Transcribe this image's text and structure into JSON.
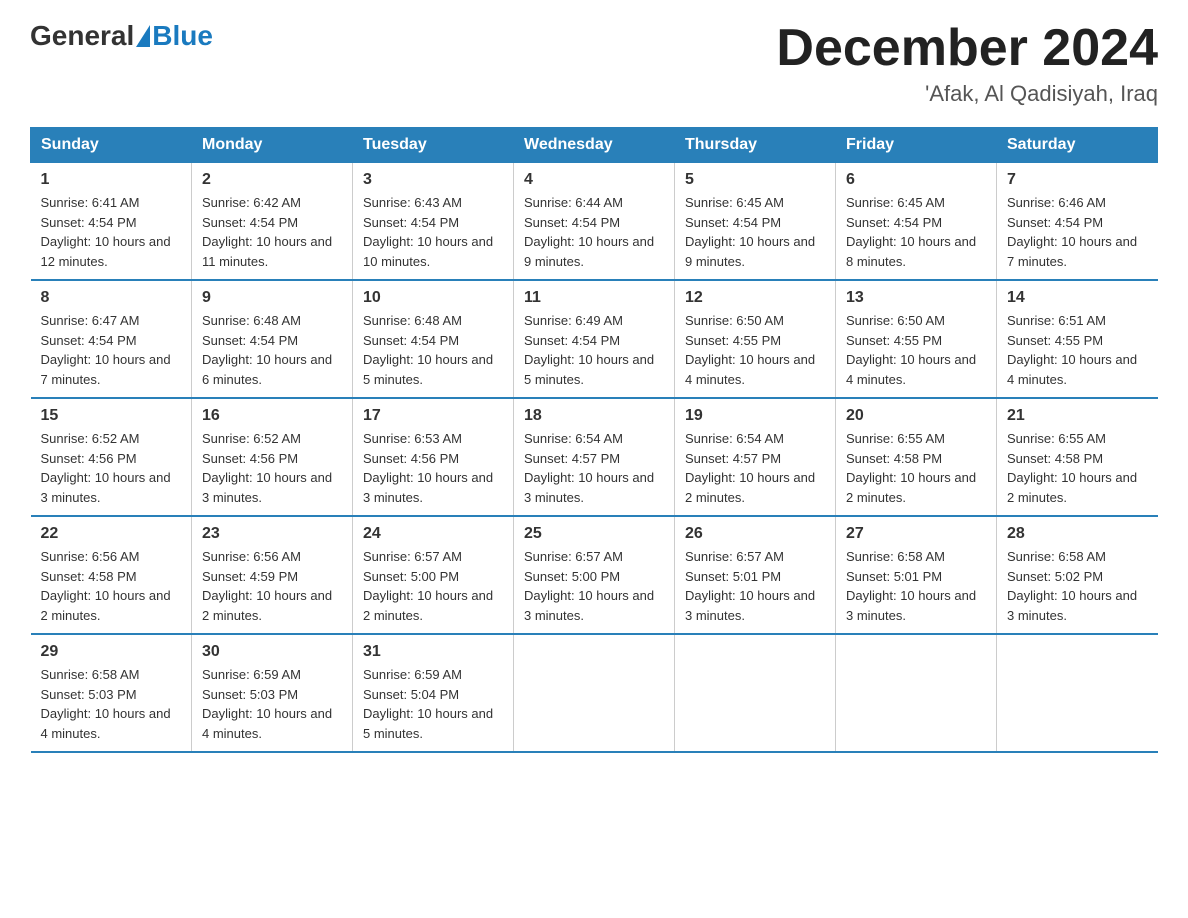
{
  "logo": {
    "general": "General",
    "blue": "Blue",
    "subtitle": ""
  },
  "title": "December 2024",
  "location": "'Afak, Al Qadisiyah, Iraq",
  "headers": [
    "Sunday",
    "Monday",
    "Tuesday",
    "Wednesday",
    "Thursday",
    "Friday",
    "Saturday"
  ],
  "weeks": [
    [
      {
        "day": "1",
        "sunrise": "Sunrise: 6:41 AM",
        "sunset": "Sunset: 4:54 PM",
        "daylight": "Daylight: 10 hours and 12 minutes."
      },
      {
        "day": "2",
        "sunrise": "Sunrise: 6:42 AM",
        "sunset": "Sunset: 4:54 PM",
        "daylight": "Daylight: 10 hours and 11 minutes."
      },
      {
        "day": "3",
        "sunrise": "Sunrise: 6:43 AM",
        "sunset": "Sunset: 4:54 PM",
        "daylight": "Daylight: 10 hours and 10 minutes."
      },
      {
        "day": "4",
        "sunrise": "Sunrise: 6:44 AM",
        "sunset": "Sunset: 4:54 PM",
        "daylight": "Daylight: 10 hours and 9 minutes."
      },
      {
        "day": "5",
        "sunrise": "Sunrise: 6:45 AM",
        "sunset": "Sunset: 4:54 PM",
        "daylight": "Daylight: 10 hours and 9 minutes."
      },
      {
        "day": "6",
        "sunrise": "Sunrise: 6:45 AM",
        "sunset": "Sunset: 4:54 PM",
        "daylight": "Daylight: 10 hours and 8 minutes."
      },
      {
        "day": "7",
        "sunrise": "Sunrise: 6:46 AM",
        "sunset": "Sunset: 4:54 PM",
        "daylight": "Daylight: 10 hours and 7 minutes."
      }
    ],
    [
      {
        "day": "8",
        "sunrise": "Sunrise: 6:47 AM",
        "sunset": "Sunset: 4:54 PM",
        "daylight": "Daylight: 10 hours and 7 minutes."
      },
      {
        "day": "9",
        "sunrise": "Sunrise: 6:48 AM",
        "sunset": "Sunset: 4:54 PM",
        "daylight": "Daylight: 10 hours and 6 minutes."
      },
      {
        "day": "10",
        "sunrise": "Sunrise: 6:48 AM",
        "sunset": "Sunset: 4:54 PM",
        "daylight": "Daylight: 10 hours and 5 minutes."
      },
      {
        "day": "11",
        "sunrise": "Sunrise: 6:49 AM",
        "sunset": "Sunset: 4:54 PM",
        "daylight": "Daylight: 10 hours and 5 minutes."
      },
      {
        "day": "12",
        "sunrise": "Sunrise: 6:50 AM",
        "sunset": "Sunset: 4:55 PM",
        "daylight": "Daylight: 10 hours and 4 minutes."
      },
      {
        "day": "13",
        "sunrise": "Sunrise: 6:50 AM",
        "sunset": "Sunset: 4:55 PM",
        "daylight": "Daylight: 10 hours and 4 minutes."
      },
      {
        "day": "14",
        "sunrise": "Sunrise: 6:51 AM",
        "sunset": "Sunset: 4:55 PM",
        "daylight": "Daylight: 10 hours and 4 minutes."
      }
    ],
    [
      {
        "day": "15",
        "sunrise": "Sunrise: 6:52 AM",
        "sunset": "Sunset: 4:56 PM",
        "daylight": "Daylight: 10 hours and 3 minutes."
      },
      {
        "day": "16",
        "sunrise": "Sunrise: 6:52 AM",
        "sunset": "Sunset: 4:56 PM",
        "daylight": "Daylight: 10 hours and 3 minutes."
      },
      {
        "day": "17",
        "sunrise": "Sunrise: 6:53 AM",
        "sunset": "Sunset: 4:56 PM",
        "daylight": "Daylight: 10 hours and 3 minutes."
      },
      {
        "day": "18",
        "sunrise": "Sunrise: 6:54 AM",
        "sunset": "Sunset: 4:57 PM",
        "daylight": "Daylight: 10 hours and 3 minutes."
      },
      {
        "day": "19",
        "sunrise": "Sunrise: 6:54 AM",
        "sunset": "Sunset: 4:57 PM",
        "daylight": "Daylight: 10 hours and 2 minutes."
      },
      {
        "day": "20",
        "sunrise": "Sunrise: 6:55 AM",
        "sunset": "Sunset: 4:58 PM",
        "daylight": "Daylight: 10 hours and 2 minutes."
      },
      {
        "day": "21",
        "sunrise": "Sunrise: 6:55 AM",
        "sunset": "Sunset: 4:58 PM",
        "daylight": "Daylight: 10 hours and 2 minutes."
      }
    ],
    [
      {
        "day": "22",
        "sunrise": "Sunrise: 6:56 AM",
        "sunset": "Sunset: 4:58 PM",
        "daylight": "Daylight: 10 hours and 2 minutes."
      },
      {
        "day": "23",
        "sunrise": "Sunrise: 6:56 AM",
        "sunset": "Sunset: 4:59 PM",
        "daylight": "Daylight: 10 hours and 2 minutes."
      },
      {
        "day": "24",
        "sunrise": "Sunrise: 6:57 AM",
        "sunset": "Sunset: 5:00 PM",
        "daylight": "Daylight: 10 hours and 2 minutes."
      },
      {
        "day": "25",
        "sunrise": "Sunrise: 6:57 AM",
        "sunset": "Sunset: 5:00 PM",
        "daylight": "Daylight: 10 hours and 3 minutes."
      },
      {
        "day": "26",
        "sunrise": "Sunrise: 6:57 AM",
        "sunset": "Sunset: 5:01 PM",
        "daylight": "Daylight: 10 hours and 3 minutes."
      },
      {
        "day": "27",
        "sunrise": "Sunrise: 6:58 AM",
        "sunset": "Sunset: 5:01 PM",
        "daylight": "Daylight: 10 hours and 3 minutes."
      },
      {
        "day": "28",
        "sunrise": "Sunrise: 6:58 AM",
        "sunset": "Sunset: 5:02 PM",
        "daylight": "Daylight: 10 hours and 3 minutes."
      }
    ],
    [
      {
        "day": "29",
        "sunrise": "Sunrise: 6:58 AM",
        "sunset": "Sunset: 5:03 PM",
        "daylight": "Daylight: 10 hours and 4 minutes."
      },
      {
        "day": "30",
        "sunrise": "Sunrise: 6:59 AM",
        "sunset": "Sunset: 5:03 PM",
        "daylight": "Daylight: 10 hours and 4 minutes."
      },
      {
        "day": "31",
        "sunrise": "Sunrise: 6:59 AM",
        "sunset": "Sunset: 5:04 PM",
        "daylight": "Daylight: 10 hours and 5 minutes."
      },
      null,
      null,
      null,
      null
    ]
  ]
}
